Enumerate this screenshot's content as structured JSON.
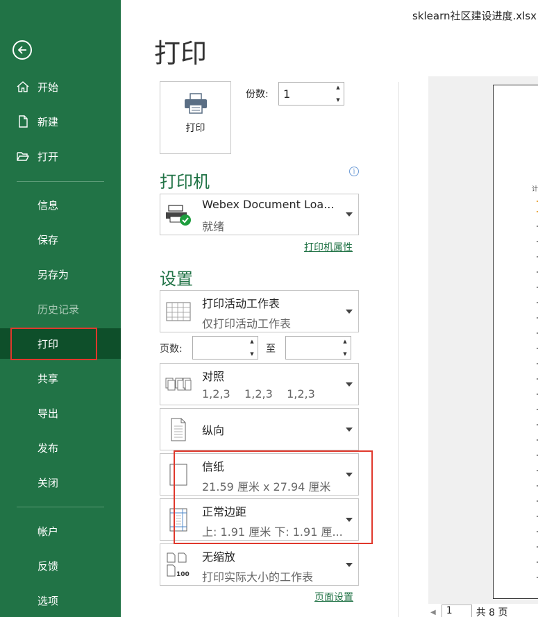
{
  "window": {
    "file_name": "sklearn社区建设进度.xlsx"
  },
  "sidebar": {
    "items": [
      {
        "label": "开始",
        "icon": "home-icon"
      },
      {
        "label": "新建",
        "icon": "new-file-icon"
      },
      {
        "label": "打开",
        "icon": "open-folder-icon"
      },
      {
        "label": "信息"
      },
      {
        "label": "保存"
      },
      {
        "label": "另存为"
      },
      {
        "label": "历史记录",
        "disabled": true
      },
      {
        "label": "打印",
        "active": true
      },
      {
        "label": "共享"
      },
      {
        "label": "导出"
      },
      {
        "label": "发布"
      },
      {
        "label": "关闭"
      },
      {
        "label": "帐户"
      },
      {
        "label": "反馈"
      },
      {
        "label": "选项"
      }
    ]
  },
  "page": {
    "title": "打印"
  },
  "print": {
    "button_label": "打印",
    "copies_label": "份数:",
    "copies_value": "1"
  },
  "printer": {
    "section_title": "打印机",
    "name": "Webex Document Loa...",
    "status": "就绪",
    "properties_link": "打印机属性"
  },
  "settings": {
    "section_title": "设置",
    "what": {
      "title": "打印活动工作表",
      "subtitle": "仅打印活动工作表"
    },
    "pages_label": "页数:",
    "pages_from": "",
    "to_label": "至",
    "pages_to": "",
    "collate": {
      "title": "对照",
      "subtitle": "1,2,3    1,2,3    1,2,3"
    },
    "orientation": {
      "title": "纵向"
    },
    "paper": {
      "title": "信纸",
      "subtitle": "21.59 厘米 x 27.94 厘米"
    },
    "margins": {
      "title": "正常边距",
      "subtitle": "上: 1.91 厘米 下: 1.91 厘..."
    },
    "scaling": {
      "title": "无缩放",
      "subtitle": "打印实际大小的工作表"
    },
    "page_setup_link": "页面设置"
  },
  "preview": {
    "page_text": "计",
    "page_number": "1",
    "page_total": "共 8 页"
  },
  "colors": {
    "accent": "#217346",
    "active_nav": "#0e4f2a",
    "highlight": "#e0382c"
  }
}
